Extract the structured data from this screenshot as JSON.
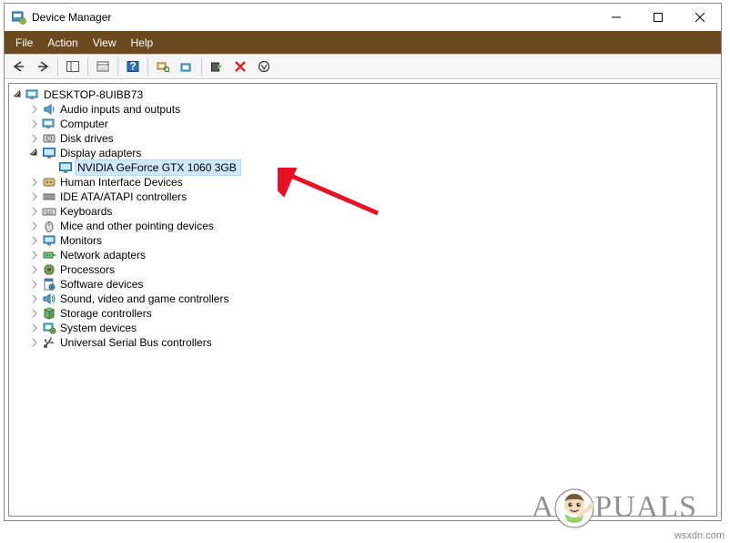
{
  "window": {
    "title": "Device Manager"
  },
  "menus": {
    "file": "File",
    "action": "Action",
    "view": "View",
    "help": "Help"
  },
  "tree": {
    "root": {
      "label": "DESKTOP-8UIBB73",
      "expanded": true
    },
    "categories": [
      {
        "label": "Audio inputs and outputs",
        "expanded": false,
        "icon": "audio"
      },
      {
        "label": "Computer",
        "expanded": false,
        "icon": "computer"
      },
      {
        "label": "Disk drives",
        "expanded": false,
        "icon": "disk"
      },
      {
        "label": "Display adapters",
        "expanded": true,
        "icon": "display",
        "children": [
          {
            "label": "NVIDIA GeForce GTX 1060 3GB",
            "icon": "display",
            "selected": true
          }
        ]
      },
      {
        "label": "Human Interface Devices",
        "expanded": false,
        "icon": "hid"
      },
      {
        "label": "IDE ATA/ATAPI controllers",
        "expanded": false,
        "icon": "ide"
      },
      {
        "label": "Keyboards",
        "expanded": false,
        "icon": "keyboard"
      },
      {
        "label": "Mice and other pointing devices",
        "expanded": false,
        "icon": "mouse"
      },
      {
        "label": "Monitors",
        "expanded": false,
        "icon": "monitor"
      },
      {
        "label": "Network adapters",
        "expanded": false,
        "icon": "network"
      },
      {
        "label": "Processors",
        "expanded": false,
        "icon": "cpu"
      },
      {
        "label": "Software devices",
        "expanded": false,
        "icon": "software"
      },
      {
        "label": "Sound, video and game controllers",
        "expanded": false,
        "icon": "sound"
      },
      {
        "label": "Storage controllers",
        "expanded": false,
        "icon": "storage"
      },
      {
        "label": "System devices",
        "expanded": false,
        "icon": "system"
      },
      {
        "label": "Universal Serial Bus controllers",
        "expanded": false,
        "icon": "usb"
      }
    ]
  },
  "watermark": {
    "pre": "A",
    "post": "PUALS"
  },
  "footer": "wsxdn.com"
}
